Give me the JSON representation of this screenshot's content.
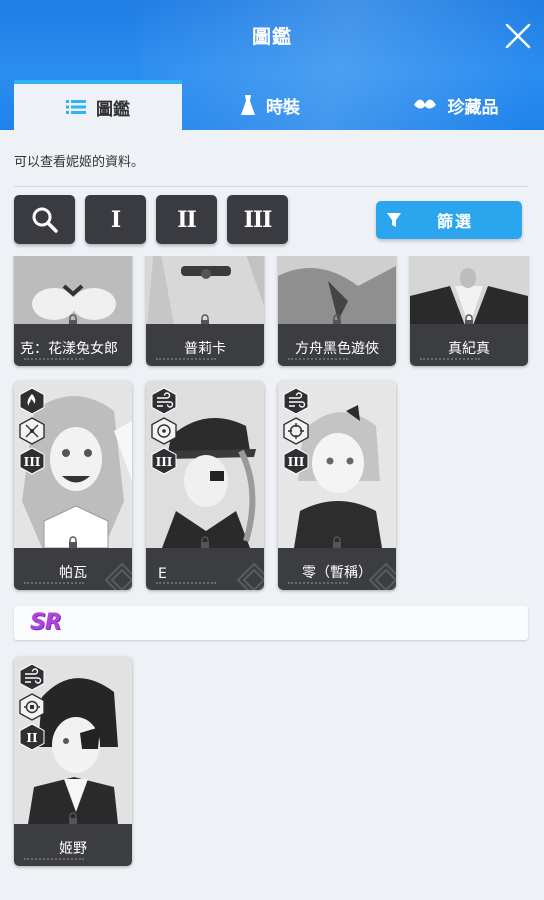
{
  "window": {
    "title": "圖鑑"
  },
  "tabs": [
    {
      "label": "圖鑑",
      "icon": "list-icon",
      "active": true
    },
    {
      "label": "時裝",
      "icon": "dress-icon",
      "active": false
    },
    {
      "label": "珍藏品",
      "icon": "collectible-icon",
      "active": false
    }
  ],
  "description": "可以查看妮姬的資料。",
  "toolbar": {
    "search_icon": "search-icon",
    "burst": [
      "I",
      "II",
      "III"
    ],
    "filter_label": "篩選"
  },
  "cards_row1": [
    {
      "name": "克：花漾兔女郎"
    },
    {
      "name": "普莉卡"
    },
    {
      "name": "方舟黑色遊俠"
    },
    {
      "name": "真紀真"
    }
  ],
  "cards_row2": [
    {
      "name": "帕瓦",
      "element": "fire-icon",
      "weapon": "shotgun-icon",
      "burst": "III"
    },
    {
      "name": "E",
      "element": "wind-icon",
      "weapon": "target-ring-icon",
      "burst": "III"
    },
    {
      "name": "零（暫稱）",
      "element": "wind-icon",
      "weapon": "crosshair-icon",
      "burst": "III"
    }
  ],
  "rarity_section": {
    "label": "SR",
    "color": "#b144d8"
  },
  "cards_sr": [
    {
      "name": "姬野",
      "element": "wind-icon",
      "weapon": "launcher-icon",
      "burst": "II"
    }
  ],
  "colors": {
    "header": "#1f7de3",
    "accent": "#2ba6ee",
    "card_bar": "#3c3d41"
  }
}
